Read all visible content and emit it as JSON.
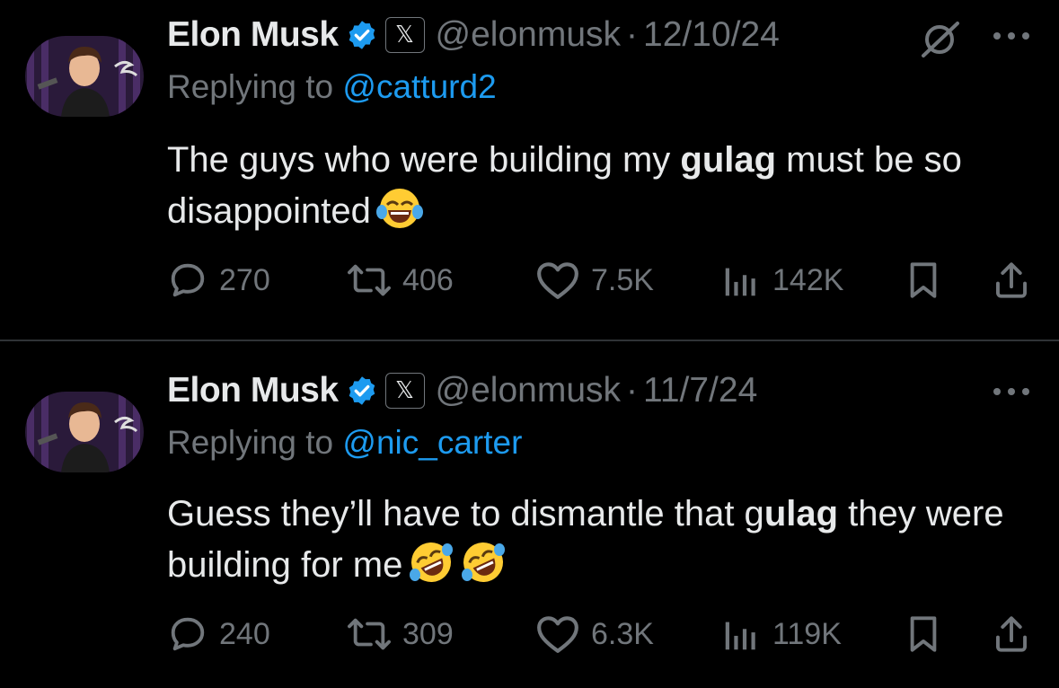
{
  "tweets": [
    {
      "author_name": "Elon Musk",
      "handle": "@elonmusk",
      "separator": "·",
      "date": "12/10/24",
      "replying_prefix": "Replying to",
      "replying_to": "@catturd2",
      "text_before": "The guys who were building my ",
      "text_bold": "gulag",
      "text_after": " must be so disappointed",
      "emoji": [
        "face-with-tears-of-joy"
      ],
      "replies": "270",
      "reposts": "406",
      "likes": "7.5K",
      "views": "142K",
      "has_grok_icon": true
    },
    {
      "author_name": "Elon Musk",
      "handle": "@elonmusk",
      "separator": "·",
      "date": "11/7/24",
      "replying_prefix": "Replying to",
      "replying_to": "@nic_carter",
      "text_before": "Guess they’ll have to dismantle that g",
      "text_bold": "ulag",
      "text_after": " they were building for me",
      "emoji": [
        "rolling-on-the-floor-laughing",
        "rolling-on-the-floor-laughing"
      ],
      "replies": "240",
      "reposts": "309",
      "likes": "6.3K",
      "views": "119K",
      "has_grok_icon": false
    }
  ],
  "colors": {
    "background": "#000000",
    "text": "#e7e9ea",
    "muted": "#71767b",
    "link": "#1d9bf0",
    "verified": "#1d9bf0",
    "divider": "#2f3336"
  }
}
